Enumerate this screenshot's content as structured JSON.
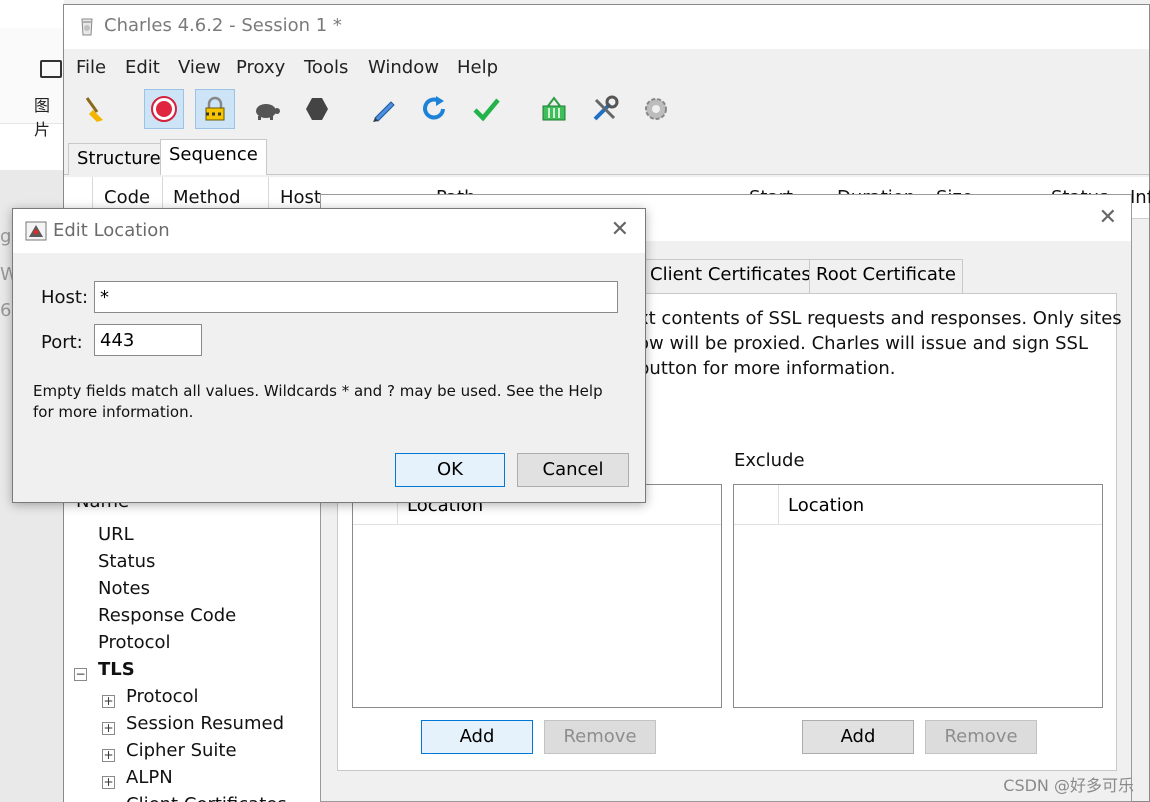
{
  "background_page": {
    "picture_label": "图片",
    "fragments": [
      "g?",
      "W",
      "6"
    ]
  },
  "charles": {
    "title": "Charles 4.6.2 - Session 1 *",
    "menu": [
      "File",
      "Edit",
      "View",
      "Proxy",
      "Tools",
      "Window",
      "Help"
    ],
    "toolbar": [
      {
        "icon": "broom-icon"
      },
      {
        "icon": "record-icon"
      },
      {
        "icon": "ssl-lock-icon"
      },
      {
        "icon": "throttle-turtle-icon"
      },
      {
        "icon": "breakpoint-hexagon-icon"
      },
      {
        "icon": "compose-pen-icon"
      },
      {
        "icon": "repeat-icon"
      },
      {
        "icon": "validate-check-icon"
      },
      {
        "icon": "shopping-basket-icon"
      },
      {
        "icon": "tools-icon"
      },
      {
        "icon": "settings-gear-icon"
      }
    ],
    "tabs": [
      "Structure",
      "Sequence"
    ],
    "columns": [
      "Code",
      "Method",
      "Host",
      "Path",
      "Start",
      "Duration",
      "Size",
      "Status",
      "Inf"
    ],
    "tree": {
      "partial_top": "Name",
      "items": [
        "URL",
        "Status",
        "Notes",
        "Response Code",
        "Protocol"
      ],
      "tls_label": "TLS",
      "tls_children": [
        "Protocol",
        "Session Resumed",
        "Cipher Suite",
        "ALPN",
        "Client Certificates"
      ]
    }
  },
  "ssl_dialog": {
    "tabs": [
      "Client Certificates",
      "Root Certificate"
    ],
    "description_lines": [
      "xt contents of SSL requests and responses. Only sites",
      "ow will be proxied. Charles will issue and sign SSL",
      "button for more information."
    ],
    "include_column": "Location",
    "exclude_label": "Exclude",
    "exclude_column": "Location",
    "add_label": "Add",
    "remove_label": "Remove"
  },
  "edit_location": {
    "title": "Edit Location",
    "host_label": "Host:",
    "host_value": "*",
    "port_label": "Port:",
    "port_value": "443",
    "help": "Empty fields match all values. Wildcards * and ? may be used. See the Help for more information.",
    "ok_label": "OK",
    "cancel_label": "Cancel"
  },
  "watermark": "CSDN @好多可乐"
}
